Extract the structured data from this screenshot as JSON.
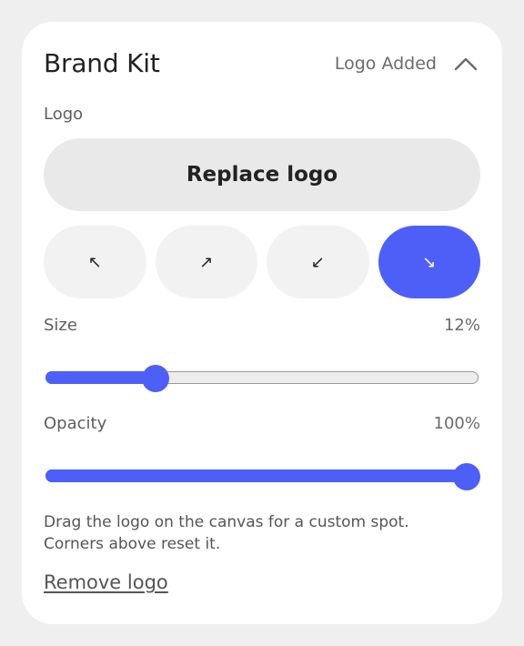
{
  "panel": {
    "title": "Brand Kit",
    "status": "Logo Added",
    "collapse_icon": "chevron-up-icon"
  },
  "logo_section": {
    "label": "Logo",
    "replace_label": "Replace logo"
  },
  "corners": [
    {
      "name": "top-left",
      "glyph": "↖",
      "active": false
    },
    {
      "name": "top-right",
      "glyph": "↗",
      "active": false
    },
    {
      "name": "bottom-left",
      "glyph": "↙",
      "active": false
    },
    {
      "name": "bottom-right",
      "glyph": "↘",
      "active": true
    }
  ],
  "size": {
    "label": "Size",
    "value_text": "12%",
    "fraction": 0.24
  },
  "opacity": {
    "label": "Opacity",
    "value_text": "100%",
    "fraction": 1.0
  },
  "hint": "Drag the logo on the canvas for a custom spot. Corners above reset it.",
  "remove_label": "Remove logo",
  "colors": {
    "accent": "#4d5ff7",
    "button_bg": "#e9e9e9",
    "corner_bg": "#f2f2f2",
    "card_bg": "#ffffff",
    "page_bg": "#efefef"
  }
}
